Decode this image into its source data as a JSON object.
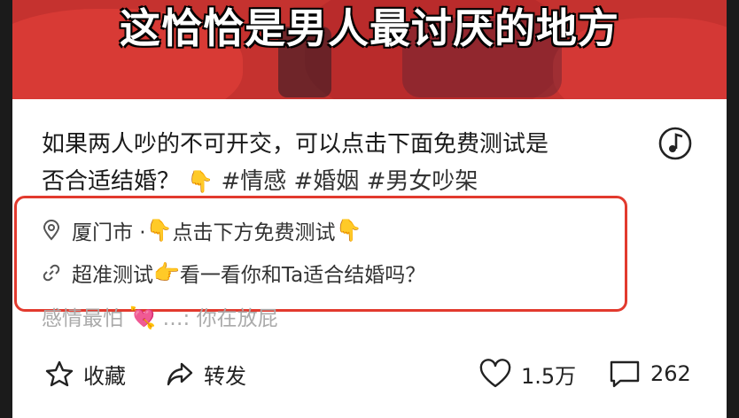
{
  "video": {
    "caption": "这恰恰是男人最讨厌的地方"
  },
  "post": {
    "description_line1": "如果两人吵的不可开交，可以点击下面免费测试是",
    "description_line2": "否合适结婚？",
    "description_emoji": "👇",
    "tags": [
      "#情感",
      "#婚姻",
      "#男女吵架"
    ]
  },
  "location": {
    "icon": "location-pin-icon",
    "city": "厦门市 · ",
    "emoji1": "👇",
    "text": "点击下方免费测试",
    "emoji2": "👇"
  },
  "link": {
    "icon": "link-icon",
    "label": "超准测试",
    "emoji": "👉",
    "text": " 看一看你和Ta适合结婚吗？"
  },
  "comment_preview": {
    "text": "感情最怕",
    "emoji": "💘",
    "rest": " …: 你在放屁"
  },
  "actions": {
    "favorite": {
      "icon": "star-icon",
      "label": "收藏"
    },
    "share": {
      "icon": "share-icon",
      "label": "转发"
    },
    "like": {
      "icon": "heart-icon",
      "count": "1.5万"
    },
    "comment": {
      "icon": "comment-icon",
      "count": "262"
    }
  },
  "colors": {
    "highlight_border": "#e23a2e",
    "video_red": "#c5322f"
  }
}
